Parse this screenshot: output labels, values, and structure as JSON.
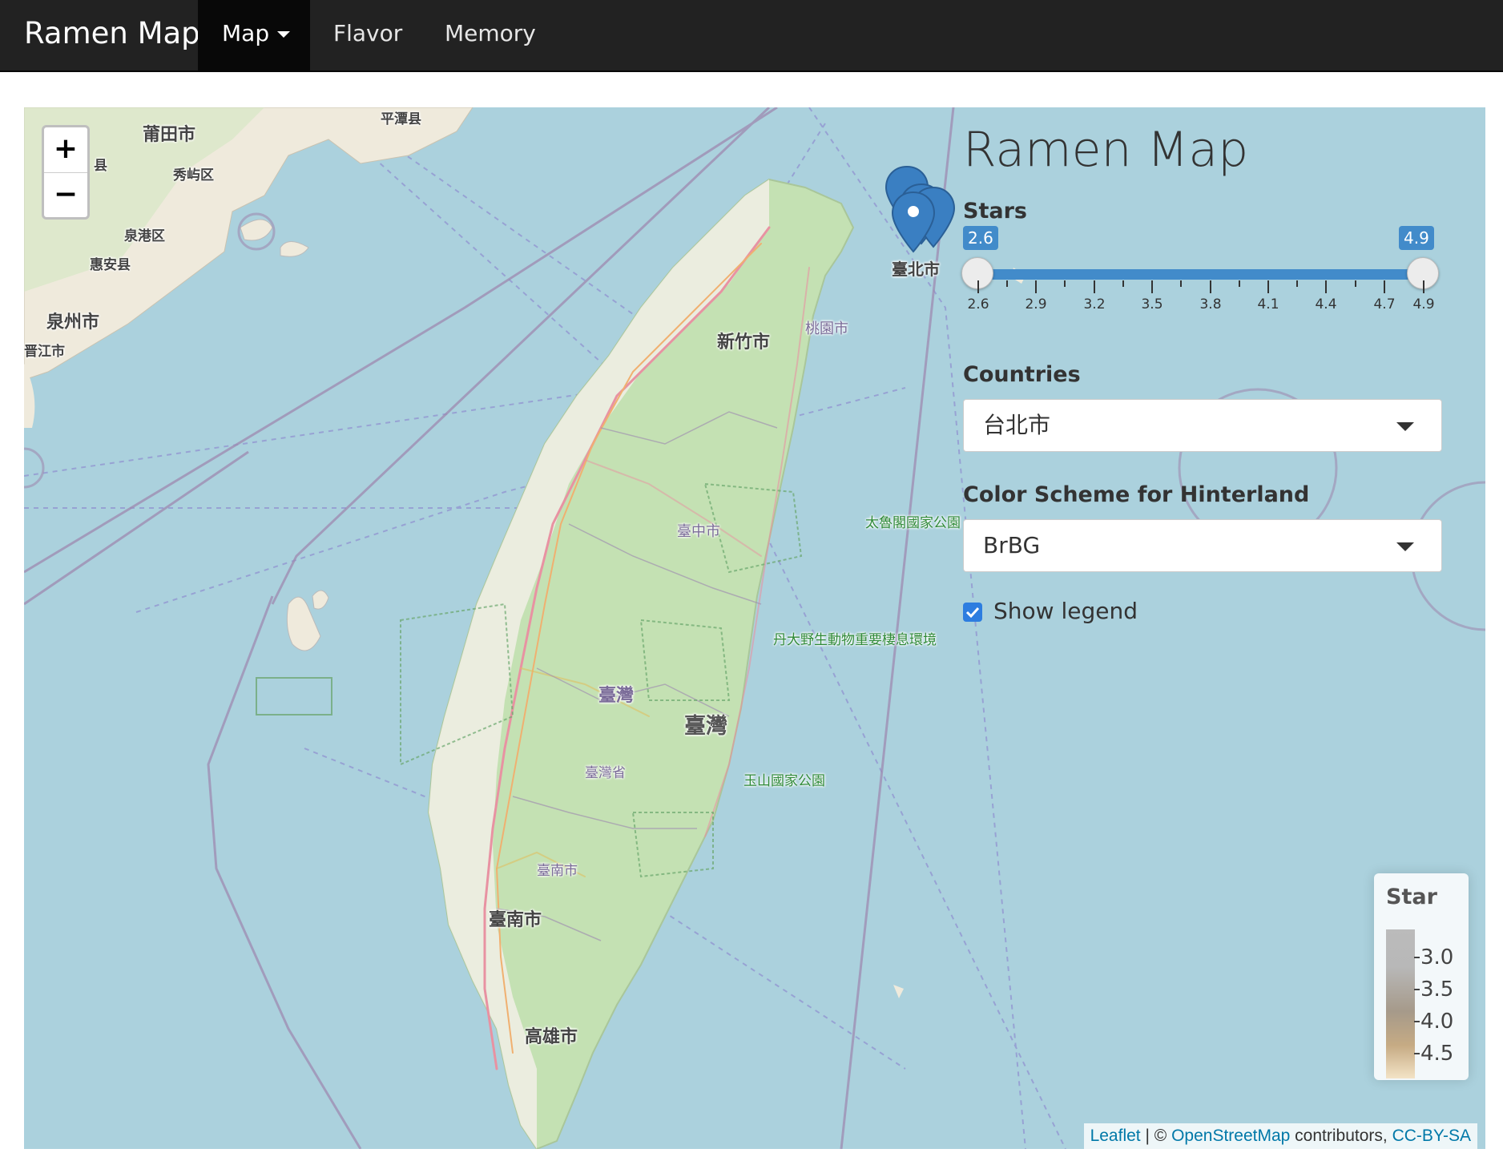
{
  "navbar": {
    "brand": "Ramen Map",
    "items": [
      {
        "label": "Map",
        "active": true,
        "dropdown": true
      },
      {
        "label": "Flavor"
      },
      {
        "label": "Memory"
      }
    ]
  },
  "map": {
    "zoom_in": "+",
    "zoom_out": "−",
    "place_labels": {
      "putian": "莆田市",
      "xiuyu": "秀屿区",
      "pingtan": "平潭县",
      "quangang": "泉港区",
      "huian": "惠安县",
      "quanzhou": "泉州市",
      "jinjiang": "晋江市",
      "county_fragment": "县",
      "taipei": "臺北市",
      "hsinchu": "新竹市",
      "taoyuan": "桃園市",
      "taichung": "臺中市",
      "taroko": "太魯閣國家公園",
      "taiwan_small": "臺灣",
      "taiwan_big": "臺灣",
      "taiwan_province": "臺灣省",
      "danda": "丹大野生動物重要棲息環境",
      "yushan": "玉山國家公園",
      "tainan_small": "臺南市",
      "tainan": "臺南市",
      "kaohsiung": "高雄市"
    },
    "marker_color": "#3a7fc2",
    "attribution": {
      "leaflet": "Leaflet",
      "separator": " | © ",
      "osm": "OpenStreetMap",
      "contributors": " contributors, ",
      "license": "CC-BY-SA"
    }
  },
  "panel": {
    "title": "Ramen Map",
    "stars": {
      "label": "Stars",
      "min_value": "2.6",
      "max_value": "4.9",
      "selected_range": [
        2.6,
        4.9
      ],
      "ticks": [
        "2.6",
        "2.9",
        "3.2",
        "3.5",
        "3.8",
        "4.1",
        "4.4",
        "4.7",
        "4.9"
      ]
    },
    "countries": {
      "label": "Countries",
      "selected": "台北市"
    },
    "color_scheme": {
      "label": "Color Scheme for Hinterland",
      "selected": "BrBG"
    },
    "show_legend": {
      "label": "Show legend",
      "checked": true
    }
  },
  "legend": {
    "title": "Star",
    "labels": [
      "3.0",
      "3.5",
      "4.0",
      "4.5"
    ],
    "colors": [
      "#bbbbbb",
      "#a69a8a",
      "#c6ab84",
      "#f3e3c6"
    ]
  },
  "colors": {
    "navbar_bg": "#222222",
    "navbar_active": "#080808",
    "slider_accent": "#428bca",
    "sea": "#abd1dd",
    "land": "#bfe0b0",
    "checkbox": "#2d7de0"
  }
}
